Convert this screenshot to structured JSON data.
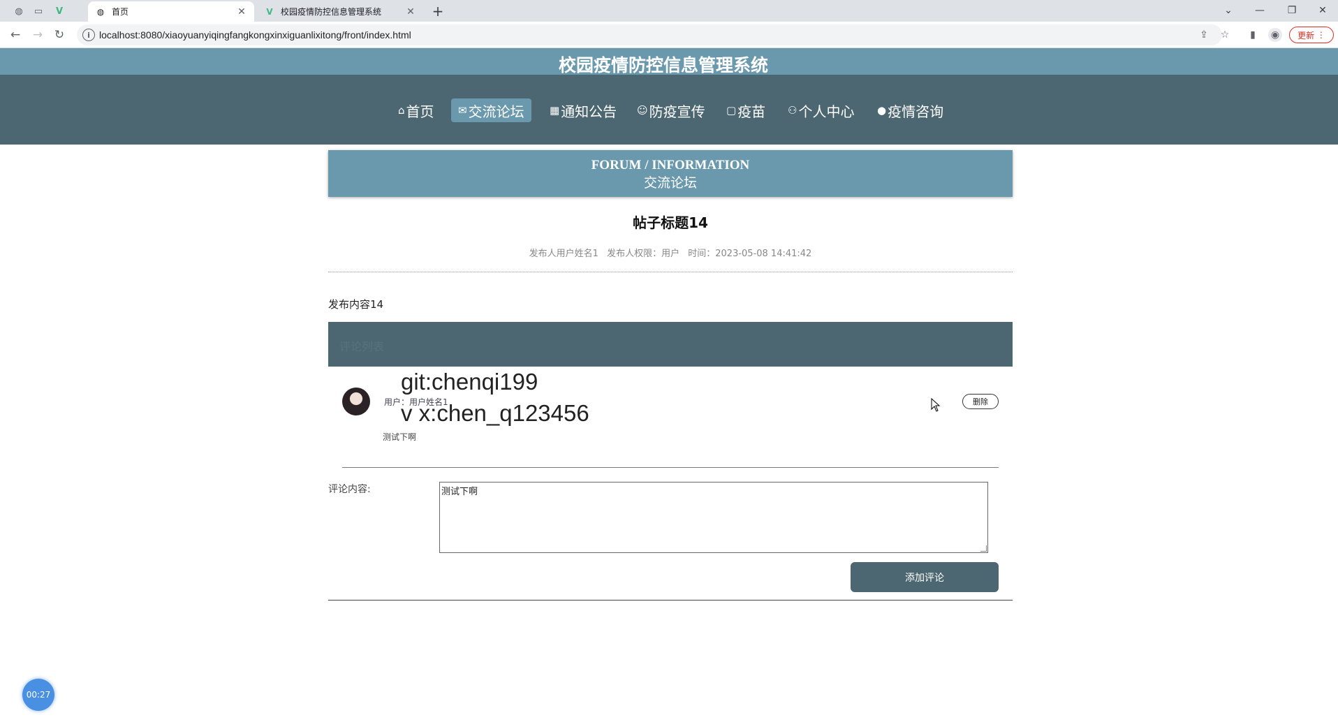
{
  "browser": {
    "tabs": [
      {
        "title": "首页",
        "icon": "globe-icon"
      },
      {
        "title": "校园疫情防控信息管理系统",
        "icon": "vue-logo-icon"
      }
    ],
    "url": "localhost:8080/xiaoyuanyiqingfangkongxinxiguanlixitong/front/index.html",
    "update_label": "更新"
  },
  "site": {
    "title": "校园疫情防控信息管理系统",
    "nav": [
      {
        "label": "首页",
        "icon": "home-icon",
        "glyph": "⌂"
      },
      {
        "label": "交流论坛",
        "icon": "mail-icon",
        "glyph": "✉",
        "active": true
      },
      {
        "label": "通知公告",
        "icon": "grid-icon",
        "glyph": "▦"
      },
      {
        "label": "防疫宣传",
        "icon": "smile-icon",
        "glyph": "☺"
      },
      {
        "label": "疫苗",
        "icon": "doc-icon",
        "glyph": "▢"
      },
      {
        "label": "个人中心",
        "icon": "user-icon",
        "glyph": "⚇"
      },
      {
        "label": "疫情咨询",
        "icon": "chat-icon",
        "glyph": "●"
      }
    ]
  },
  "section": {
    "en": "FORUM / INFORMATION",
    "cn": "交流论坛"
  },
  "post": {
    "title": "帖子标题14",
    "author": "发布人用户姓名1",
    "role": "发布人权限：用户",
    "time": "时间：2023-05-08 14:41:42",
    "content": "发布内容14"
  },
  "comments_bar_label": "评论列表",
  "comment": {
    "user": "用户：用户姓名1",
    "text": "测试下啊",
    "delete_label": "删除"
  },
  "watermark": {
    "line1": "git:chenqi199",
    "line2": "v x:chen_q123456"
  },
  "form": {
    "label": "评论内容:",
    "value": "测试下啊",
    "submit_label": "添加评论"
  },
  "timer": "00:27",
  "colors": {
    "accent": "#6a98ac",
    "nav_bg": "#4c6771"
  }
}
